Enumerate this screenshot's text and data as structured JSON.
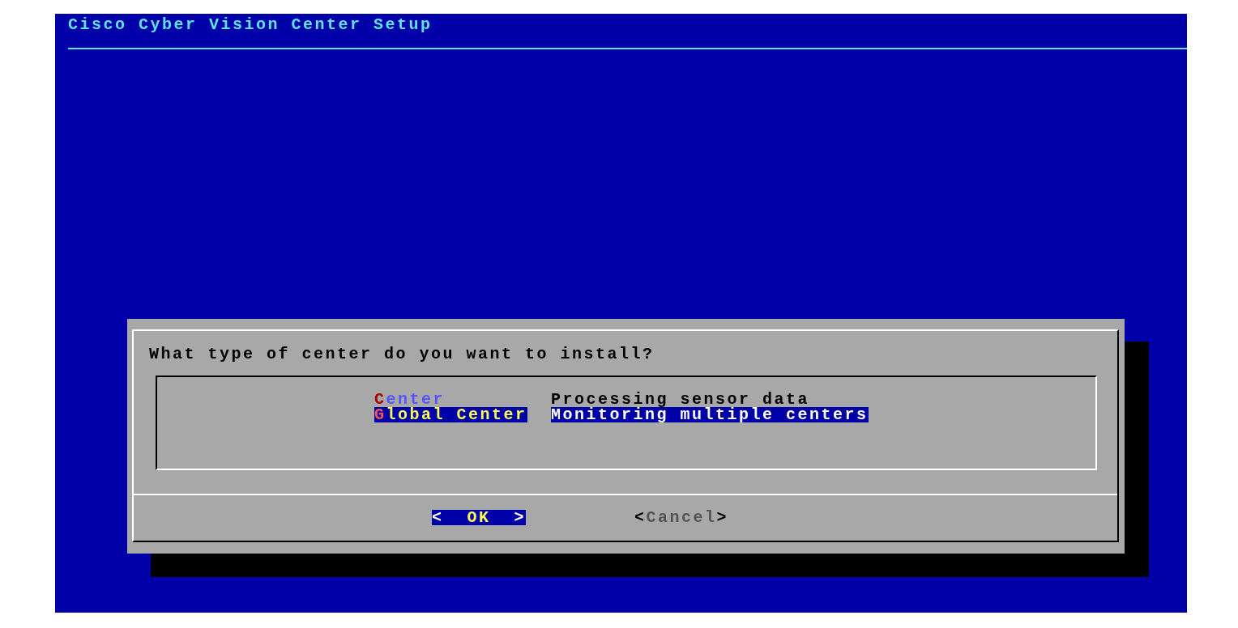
{
  "window": {
    "title": "Cisco Cyber Vision Center Setup"
  },
  "dialog": {
    "prompt": "What type of center do you want to install?",
    "items": [
      {
        "name": "Center",
        "description": "Processing sensor data",
        "selected": false
      },
      {
        "name": "Global Center",
        "description": "Monitoring multiple centers",
        "selected": true
      }
    ],
    "buttons": [
      {
        "label": "<  OK  >",
        "selected": true
      },
      {
        "label": "<Cancel>",
        "selected": false
      }
    ]
  }
}
